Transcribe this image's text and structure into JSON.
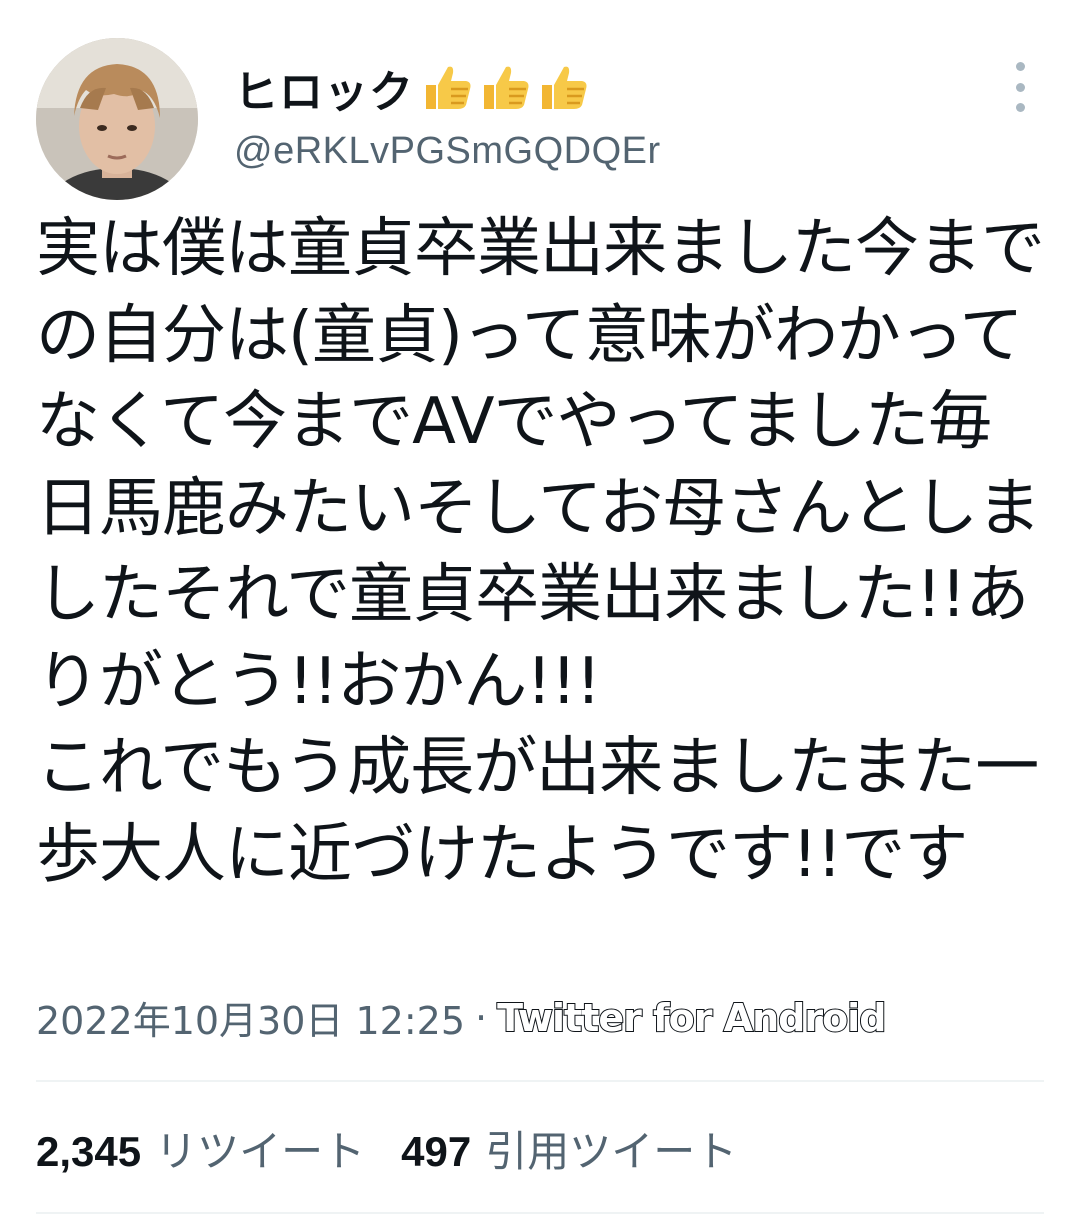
{
  "author": {
    "display_name": "ヒロック",
    "handle": "@eRKLvPGSmGQDQEr",
    "name_emoji": [
      "thumbs-up-icon",
      "thumbs-up-icon",
      "thumbs-up-icon"
    ]
  },
  "tweet": {
    "text": "実は僕は童貞卒業出来ました今までの自分は(童貞)って意味がわかってなくて今までAVでやってました毎日馬鹿みたいそしてお母さんとしましたそれで童貞卒業出来ました!!ありがとう!!おかん!!!\nこれでもう成長が出来ましたまた一歩大人に近づけたようです!!です",
    "timestamp": "2022年10月30日 12:25",
    "separator": "·",
    "source": "Twitter for Android"
  },
  "stats": {
    "retweets_count": "2,345",
    "retweets_label": "リツイート",
    "quotes_count": "497",
    "quotes_label": "引用ツイート"
  },
  "colors": {
    "text": "#0f1419",
    "secondary": "#536471",
    "divider": "#eff3f4",
    "more_dots": "#aab8c2",
    "thumb": "#f5c542"
  }
}
